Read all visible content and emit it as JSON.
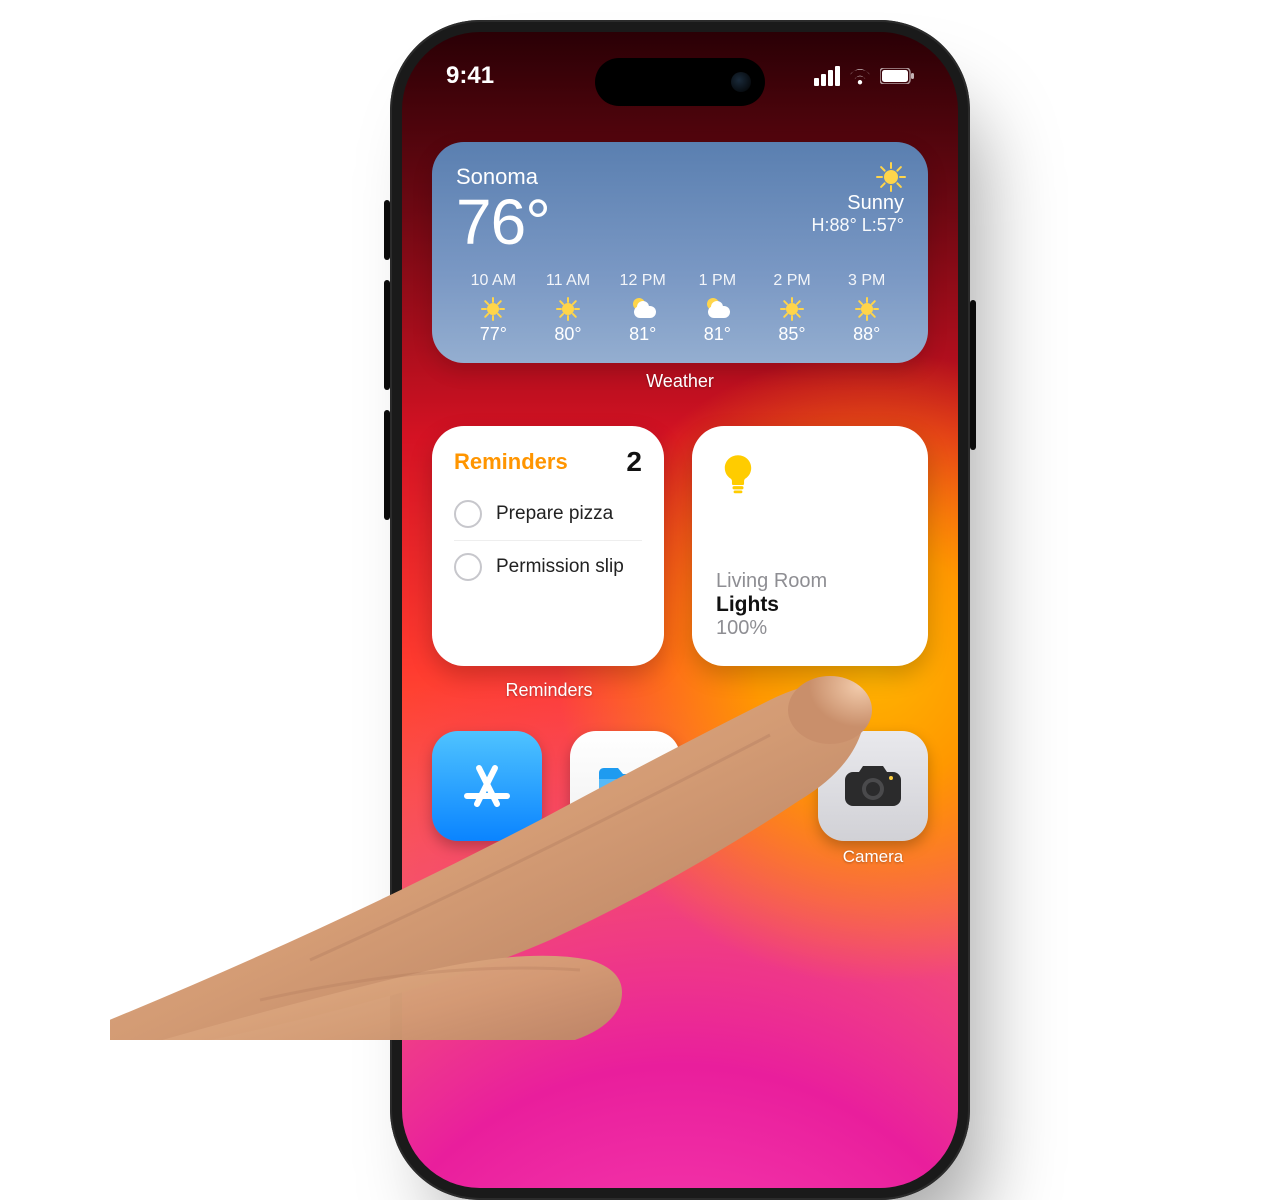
{
  "status": {
    "time": "9:41"
  },
  "weather": {
    "location": "Sonoma",
    "temperature": "76°",
    "condition": "Sunny",
    "high_low": "H:88° L:57°",
    "label": "Weather",
    "hours": [
      {
        "time": "10 AM",
        "icon": "sun",
        "temp": "77°"
      },
      {
        "time": "11 AM",
        "icon": "sun",
        "temp": "80°"
      },
      {
        "time": "12 PM",
        "icon": "partly-cloudy",
        "temp": "81°"
      },
      {
        "time": "1 PM",
        "icon": "partly-cloudy",
        "temp": "81°"
      },
      {
        "time": "2 PM",
        "icon": "sun",
        "temp": "85°"
      },
      {
        "time": "3 PM",
        "icon": "sun",
        "temp": "88°"
      }
    ]
  },
  "reminders": {
    "title": "Reminders",
    "count": "2",
    "items": [
      {
        "text": "Prepare pizza"
      },
      {
        "text": "Permission slip"
      }
    ],
    "label": "Reminders"
  },
  "home": {
    "room": "Living Room",
    "accessory": "Lights",
    "percent": "100%"
  },
  "apps": {
    "camera_label": "Camera"
  }
}
